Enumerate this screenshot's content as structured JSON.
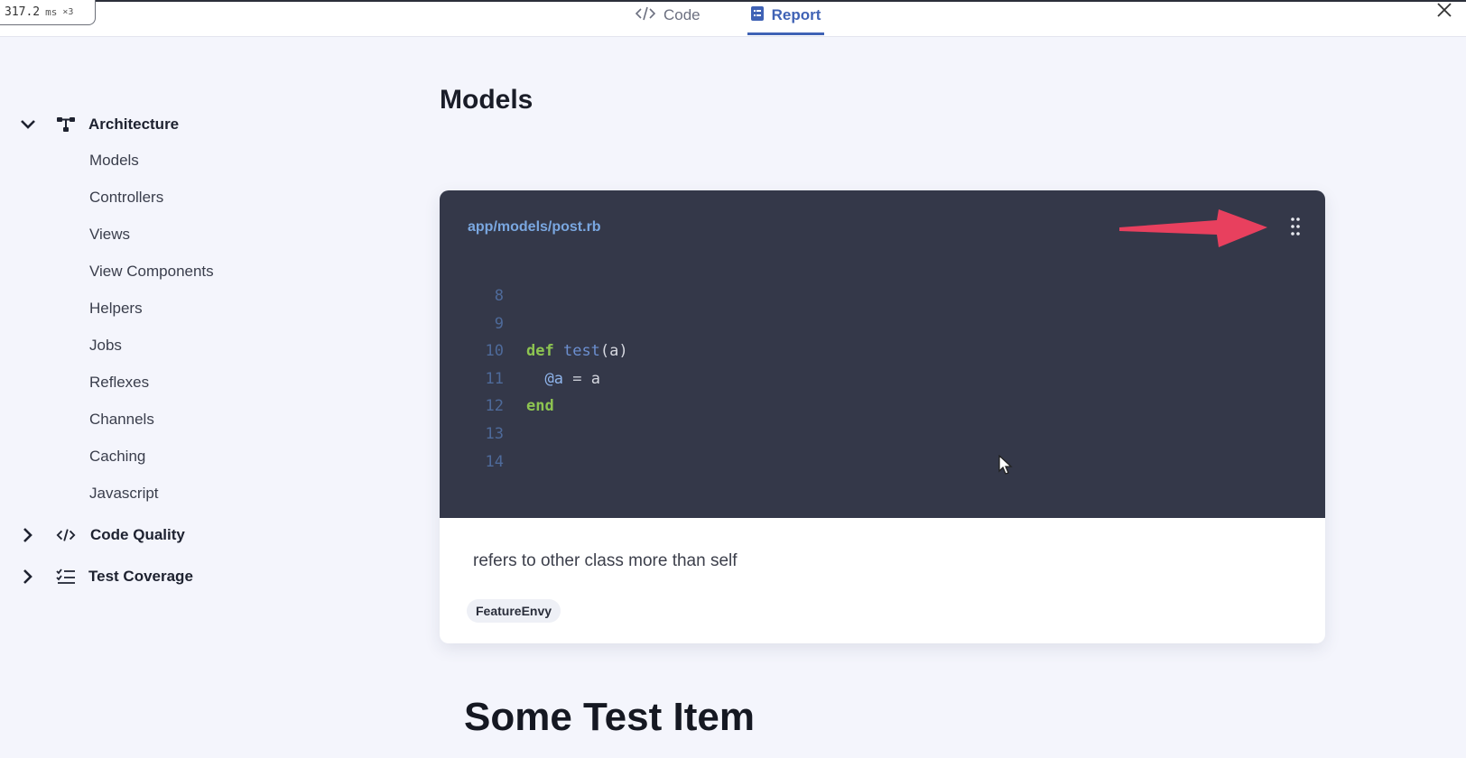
{
  "perf": {
    "value": "317.2",
    "unit": "ms",
    "multiplier": "×3"
  },
  "tabs": [
    {
      "label": "Code",
      "active": false
    },
    {
      "label": "Report",
      "active": true
    }
  ],
  "sidebar": {
    "architecture": {
      "label": "Architecture",
      "expanded": true,
      "items": [
        "Models",
        "Controllers",
        "Views",
        "View Components",
        "Helpers",
        "Jobs",
        "Reflexes",
        "Channels",
        "Caching",
        "Javascript"
      ]
    },
    "code_quality": {
      "label": "Code Quality",
      "expanded": false
    },
    "test_coverage": {
      "label": "Test Coverage",
      "expanded": false
    }
  },
  "main": {
    "title": "Models",
    "card": {
      "file_path": "app/models/post.rb",
      "code_lines": [
        {
          "num": "8",
          "text": ""
        },
        {
          "num": "9",
          "text": ""
        },
        {
          "num": "10",
          "text": "def test(a)"
        },
        {
          "num": "11",
          "text": "  @a = a"
        },
        {
          "num": "12",
          "text": "end"
        },
        {
          "num": "13",
          "text": ""
        },
        {
          "num": "14",
          "text": ""
        }
      ],
      "description": "refers to other class more than self",
      "tag": "FeatureEnvy"
    },
    "next_section_title": "Some Test Item"
  },
  "colors": {
    "accent": "#3f62b5",
    "code_bg": "#343849",
    "annotation_arrow": "#e8405e"
  }
}
